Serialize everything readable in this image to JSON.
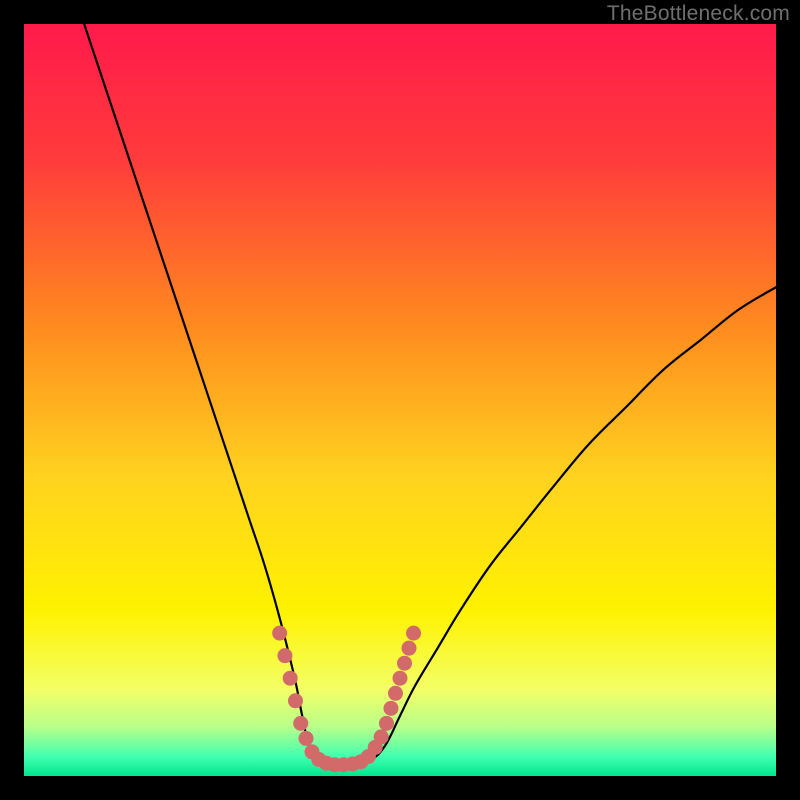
{
  "watermark": "TheBottleneck.com",
  "chart_data": {
    "type": "line",
    "title": "",
    "xlabel": "",
    "ylabel": "",
    "xlim": [
      0,
      100
    ],
    "ylim": [
      0,
      100
    ],
    "gradient_stops": [
      {
        "offset": 0.0,
        "color": "#ff1a4b"
      },
      {
        "offset": 0.18,
        "color": "#ff3b3b"
      },
      {
        "offset": 0.4,
        "color": "#ff8a1f"
      },
      {
        "offset": 0.6,
        "color": "#ffd21f"
      },
      {
        "offset": 0.78,
        "color": "#fff200"
      },
      {
        "offset": 0.885,
        "color": "#f3ff66"
      },
      {
        "offset": 0.935,
        "color": "#b7ff8a"
      },
      {
        "offset": 0.975,
        "color": "#3fffb0"
      },
      {
        "offset": 1.0,
        "color": "#00e58c"
      }
    ],
    "series": [
      {
        "name": "bottleneck-curve",
        "x": [
          8,
          10,
          12,
          14,
          16,
          18,
          20,
          22,
          24,
          26,
          28,
          30,
          32,
          34,
          36,
          37,
          38,
          40,
          42,
          44,
          46,
          48,
          50,
          52,
          55,
          58,
          62,
          66,
          70,
          75,
          80,
          85,
          90,
          95,
          100
        ],
        "y": [
          100,
          94,
          88,
          82,
          76,
          70,
          64,
          58,
          52,
          46,
          40,
          34,
          28,
          21,
          13,
          8,
          4,
          2,
          1.5,
          1.5,
          2,
          4,
          8,
          12,
          17,
          22,
          28,
          33,
          38,
          44,
          49,
          54,
          58,
          62,
          65
        ]
      }
    ],
    "highlight": {
      "name": "trough-marker",
      "color": "#d36a6a",
      "points": [
        {
          "x": 34.0,
          "y": 19
        },
        {
          "x": 34.7,
          "y": 16
        },
        {
          "x": 35.4,
          "y": 13
        },
        {
          "x": 36.1,
          "y": 10
        },
        {
          "x": 36.8,
          "y": 7
        },
        {
          "x": 37.5,
          "y": 5
        },
        {
          "x": 38.3,
          "y": 3.2
        },
        {
          "x": 39.2,
          "y": 2.2
        },
        {
          "x": 40.2,
          "y": 1.7
        },
        {
          "x": 41.3,
          "y": 1.5
        },
        {
          "x": 42.5,
          "y": 1.5
        },
        {
          "x": 43.7,
          "y": 1.6
        },
        {
          "x": 44.8,
          "y": 1.9
        },
        {
          "x": 45.8,
          "y": 2.6
        },
        {
          "x": 46.7,
          "y": 3.8
        },
        {
          "x": 47.5,
          "y": 5.2
        },
        {
          "x": 48.2,
          "y": 7
        },
        {
          "x": 48.8,
          "y": 9
        },
        {
          "x": 49.4,
          "y": 11
        },
        {
          "x": 50.0,
          "y": 13
        },
        {
          "x": 50.6,
          "y": 15
        },
        {
          "x": 51.2,
          "y": 17
        },
        {
          "x": 51.8,
          "y": 19
        }
      ]
    }
  }
}
